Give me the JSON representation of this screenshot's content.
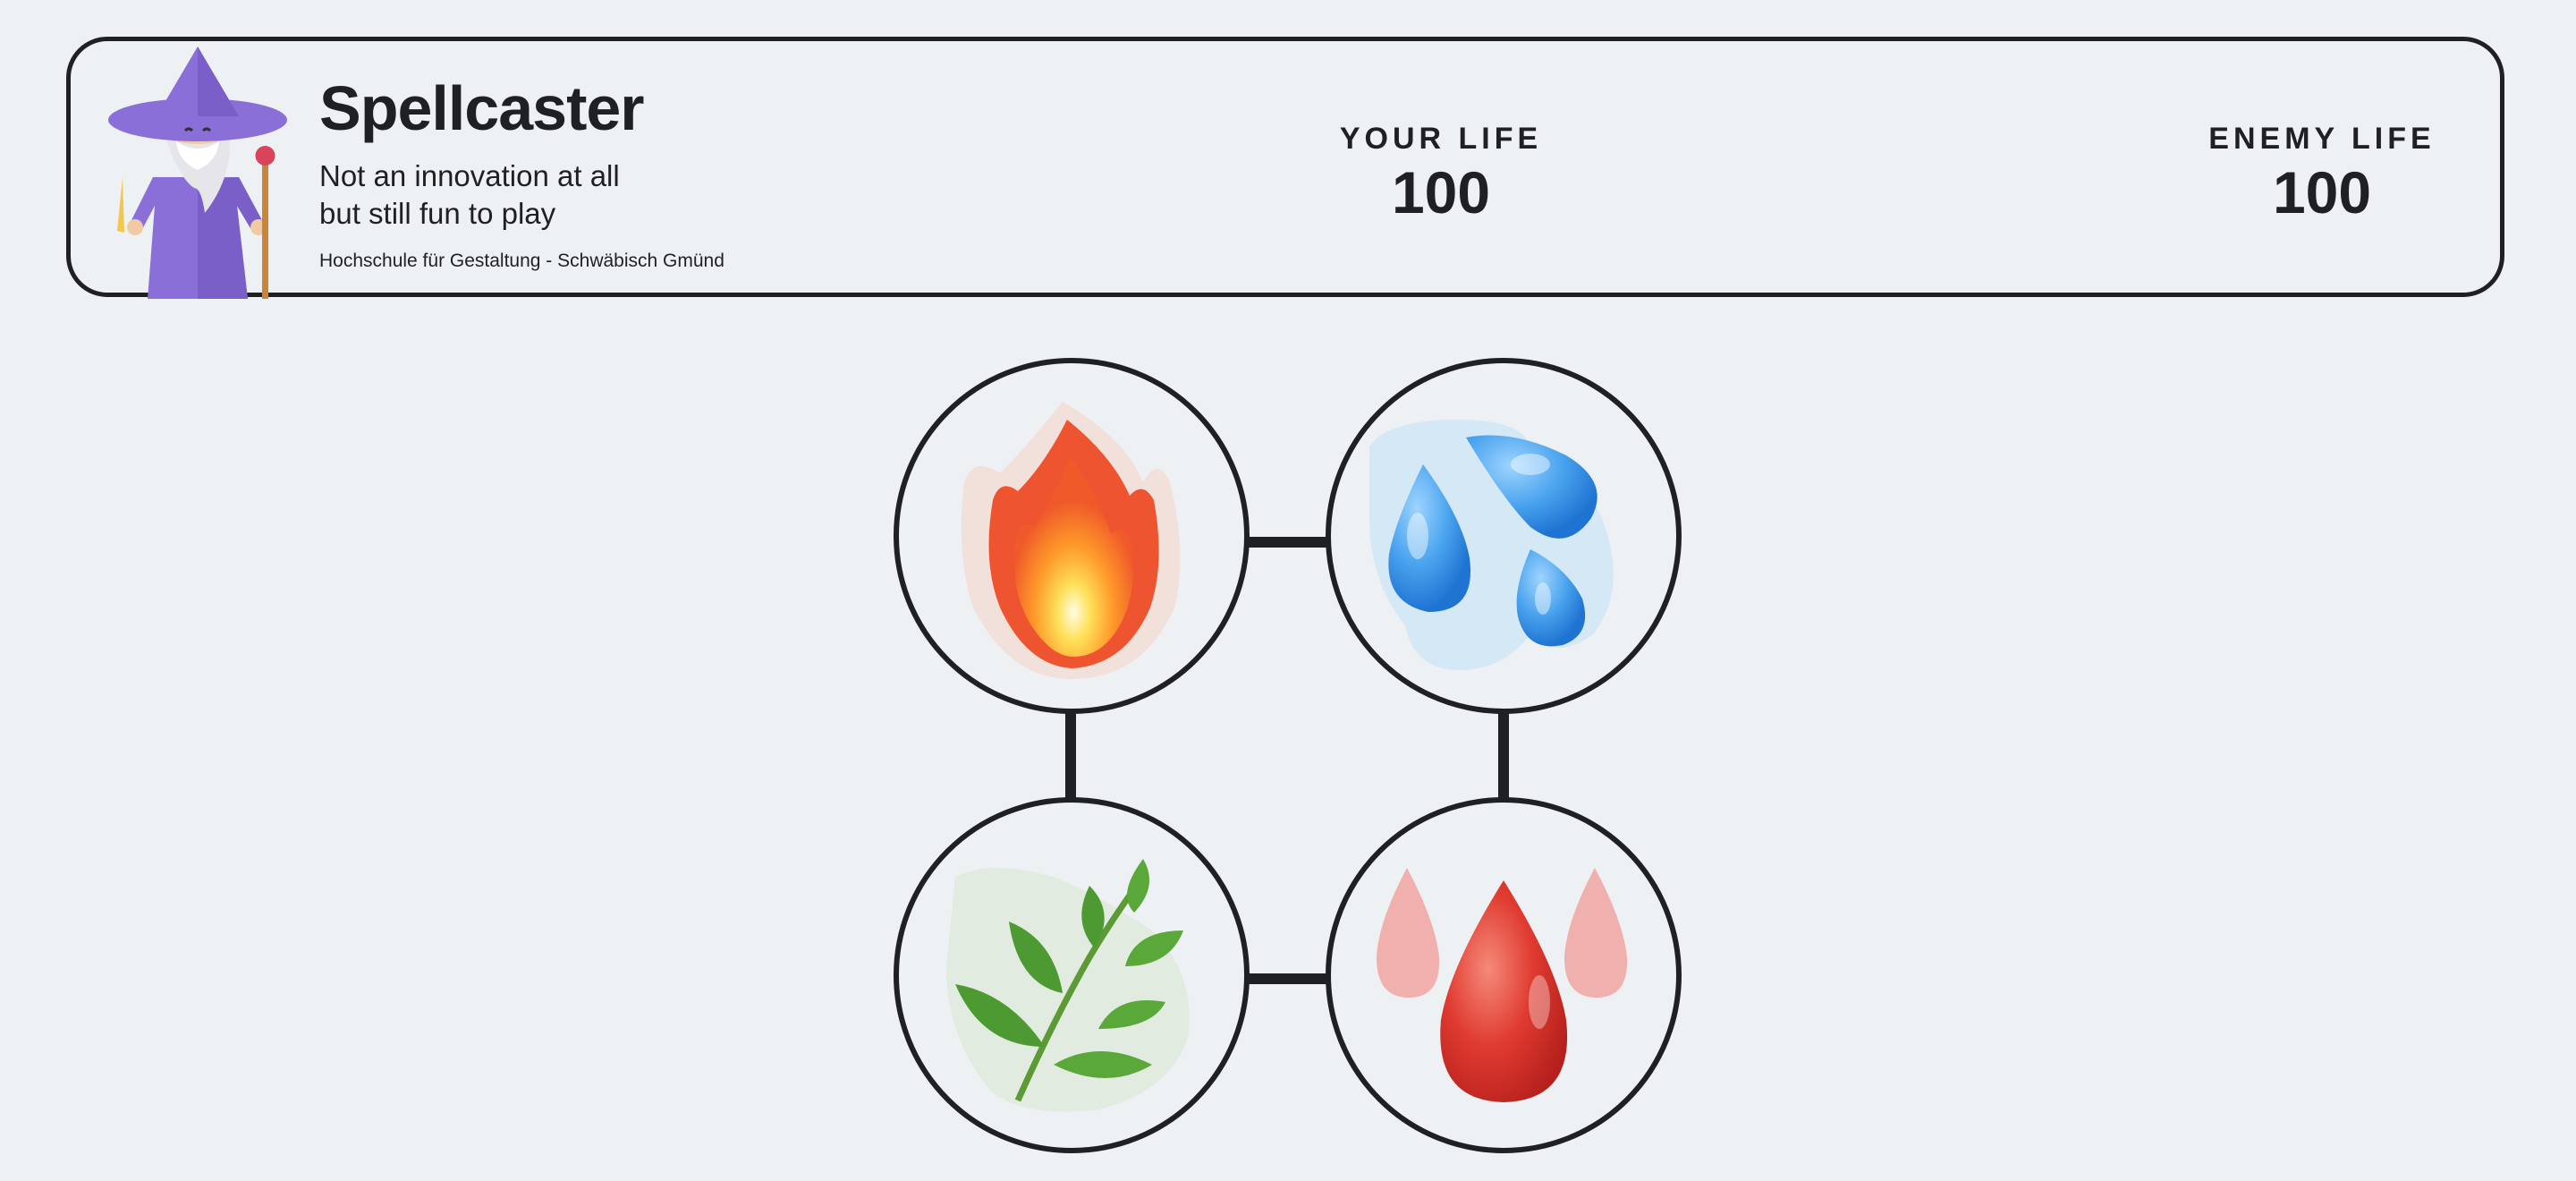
{
  "header": {
    "title": "Spellcaster",
    "tagline_line1": "Not an innovation at all",
    "tagline_line2": "but still fun to play",
    "school": "Hochschule für Gestaltung - Schwäbisch Gmünd",
    "your_life_label": "YOUR LIFE",
    "your_life_value": "100",
    "enemy_life_label": "ENEMY LIFE",
    "enemy_life_value": "100",
    "logo_icon": "wizard-icon"
  },
  "elements": [
    {
      "id": "fire",
      "icon": "fire-icon"
    },
    {
      "id": "water",
      "icon": "water-drops-icon"
    },
    {
      "id": "leaf",
      "icon": "leaf-icon"
    },
    {
      "id": "blood",
      "icon": "blood-drop-icon"
    }
  ],
  "colors": {
    "background": "#eef1f4",
    "outline": "#1f2023",
    "wizard_robe": "#8b6fd8",
    "fire": "#f4632a",
    "water": "#3c97ea",
    "leaf": "#5aa83a",
    "blood": "#d9302a"
  }
}
